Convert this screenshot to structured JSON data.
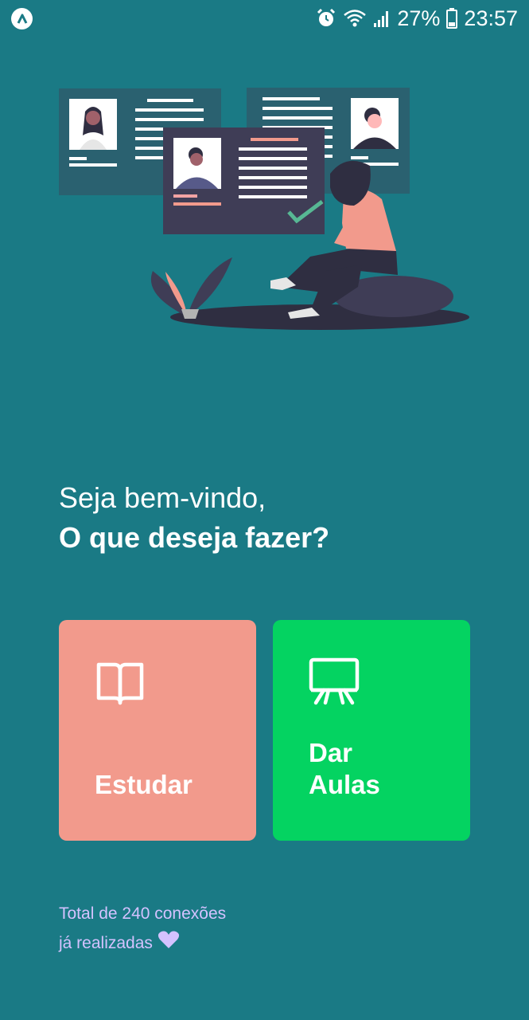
{
  "status_bar": {
    "battery_text": "27%",
    "time": "23:57",
    "icons": [
      "app-logo-icon",
      "alarm-icon",
      "wifi-icon",
      "signal-icon",
      "battery-icon"
    ]
  },
  "welcome": {
    "greeting": "Seja bem-vindo,",
    "question": "O que deseja fazer?"
  },
  "actions": {
    "study": {
      "label": "Estudar",
      "icon": "book-open-icon",
      "color": "#f29a8c"
    },
    "teach": {
      "label_line1": "Dar",
      "label_line2": "Aulas",
      "icon": "presentation-board-icon",
      "color": "#04d361"
    }
  },
  "footer": {
    "line1": "Total de 240 conexões",
    "line2": "já realizadas",
    "icon": "heart-icon"
  },
  "colors": {
    "background": "#1a7a85",
    "footer_text": "#d4c2ff"
  }
}
